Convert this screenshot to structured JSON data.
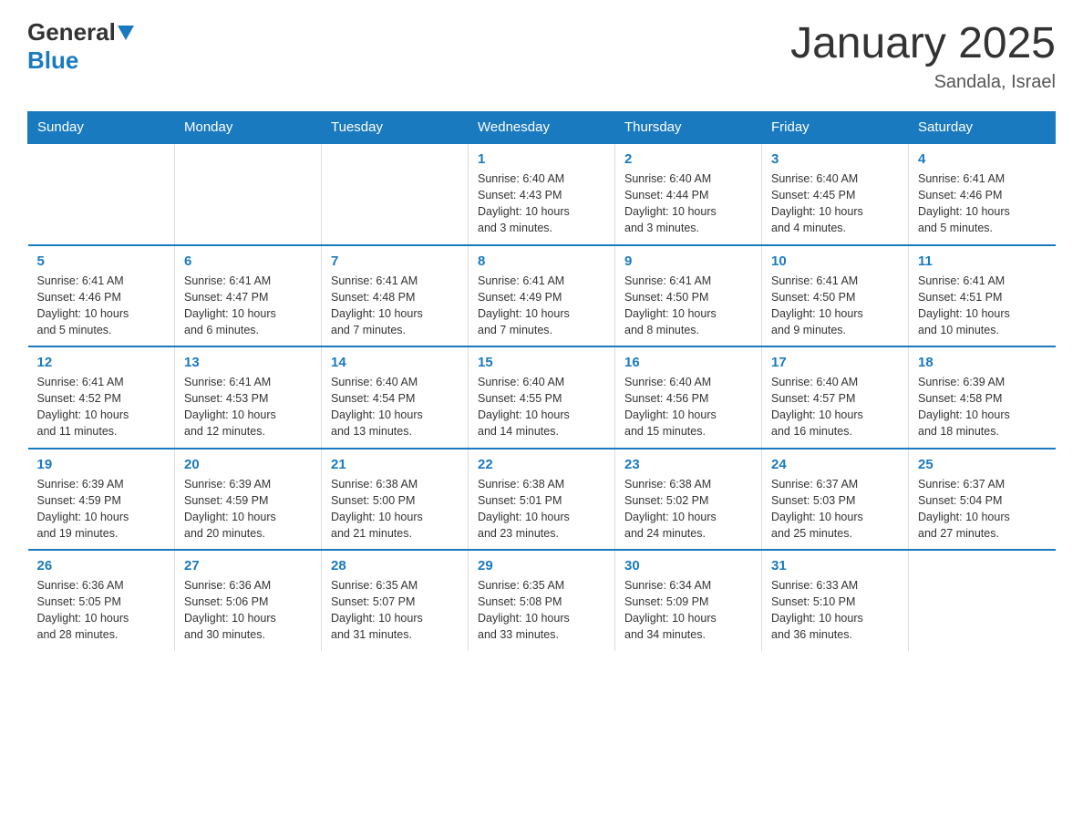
{
  "header": {
    "logo_general": "General",
    "logo_blue": "Blue",
    "month_title": "January 2025",
    "location": "Sandala, Israel"
  },
  "weekdays": [
    "Sunday",
    "Monday",
    "Tuesday",
    "Wednesday",
    "Thursday",
    "Friday",
    "Saturday"
  ],
  "weeks": [
    [
      {
        "day": "",
        "info": ""
      },
      {
        "day": "",
        "info": ""
      },
      {
        "day": "",
        "info": ""
      },
      {
        "day": "1",
        "info": "Sunrise: 6:40 AM\nSunset: 4:43 PM\nDaylight: 10 hours\nand 3 minutes."
      },
      {
        "day": "2",
        "info": "Sunrise: 6:40 AM\nSunset: 4:44 PM\nDaylight: 10 hours\nand 3 minutes."
      },
      {
        "day": "3",
        "info": "Sunrise: 6:40 AM\nSunset: 4:45 PM\nDaylight: 10 hours\nand 4 minutes."
      },
      {
        "day": "4",
        "info": "Sunrise: 6:41 AM\nSunset: 4:46 PM\nDaylight: 10 hours\nand 5 minutes."
      }
    ],
    [
      {
        "day": "5",
        "info": "Sunrise: 6:41 AM\nSunset: 4:46 PM\nDaylight: 10 hours\nand 5 minutes."
      },
      {
        "day": "6",
        "info": "Sunrise: 6:41 AM\nSunset: 4:47 PM\nDaylight: 10 hours\nand 6 minutes."
      },
      {
        "day": "7",
        "info": "Sunrise: 6:41 AM\nSunset: 4:48 PM\nDaylight: 10 hours\nand 7 minutes."
      },
      {
        "day": "8",
        "info": "Sunrise: 6:41 AM\nSunset: 4:49 PM\nDaylight: 10 hours\nand 7 minutes."
      },
      {
        "day": "9",
        "info": "Sunrise: 6:41 AM\nSunset: 4:50 PM\nDaylight: 10 hours\nand 8 minutes."
      },
      {
        "day": "10",
        "info": "Sunrise: 6:41 AM\nSunset: 4:50 PM\nDaylight: 10 hours\nand 9 minutes."
      },
      {
        "day": "11",
        "info": "Sunrise: 6:41 AM\nSunset: 4:51 PM\nDaylight: 10 hours\nand 10 minutes."
      }
    ],
    [
      {
        "day": "12",
        "info": "Sunrise: 6:41 AM\nSunset: 4:52 PM\nDaylight: 10 hours\nand 11 minutes."
      },
      {
        "day": "13",
        "info": "Sunrise: 6:41 AM\nSunset: 4:53 PM\nDaylight: 10 hours\nand 12 minutes."
      },
      {
        "day": "14",
        "info": "Sunrise: 6:40 AM\nSunset: 4:54 PM\nDaylight: 10 hours\nand 13 minutes."
      },
      {
        "day": "15",
        "info": "Sunrise: 6:40 AM\nSunset: 4:55 PM\nDaylight: 10 hours\nand 14 minutes."
      },
      {
        "day": "16",
        "info": "Sunrise: 6:40 AM\nSunset: 4:56 PM\nDaylight: 10 hours\nand 15 minutes."
      },
      {
        "day": "17",
        "info": "Sunrise: 6:40 AM\nSunset: 4:57 PM\nDaylight: 10 hours\nand 16 minutes."
      },
      {
        "day": "18",
        "info": "Sunrise: 6:39 AM\nSunset: 4:58 PM\nDaylight: 10 hours\nand 18 minutes."
      }
    ],
    [
      {
        "day": "19",
        "info": "Sunrise: 6:39 AM\nSunset: 4:59 PM\nDaylight: 10 hours\nand 19 minutes."
      },
      {
        "day": "20",
        "info": "Sunrise: 6:39 AM\nSunset: 4:59 PM\nDaylight: 10 hours\nand 20 minutes."
      },
      {
        "day": "21",
        "info": "Sunrise: 6:38 AM\nSunset: 5:00 PM\nDaylight: 10 hours\nand 21 minutes."
      },
      {
        "day": "22",
        "info": "Sunrise: 6:38 AM\nSunset: 5:01 PM\nDaylight: 10 hours\nand 23 minutes."
      },
      {
        "day": "23",
        "info": "Sunrise: 6:38 AM\nSunset: 5:02 PM\nDaylight: 10 hours\nand 24 minutes."
      },
      {
        "day": "24",
        "info": "Sunrise: 6:37 AM\nSunset: 5:03 PM\nDaylight: 10 hours\nand 25 minutes."
      },
      {
        "day": "25",
        "info": "Sunrise: 6:37 AM\nSunset: 5:04 PM\nDaylight: 10 hours\nand 27 minutes."
      }
    ],
    [
      {
        "day": "26",
        "info": "Sunrise: 6:36 AM\nSunset: 5:05 PM\nDaylight: 10 hours\nand 28 minutes."
      },
      {
        "day": "27",
        "info": "Sunrise: 6:36 AM\nSunset: 5:06 PM\nDaylight: 10 hours\nand 30 minutes."
      },
      {
        "day": "28",
        "info": "Sunrise: 6:35 AM\nSunset: 5:07 PM\nDaylight: 10 hours\nand 31 minutes."
      },
      {
        "day": "29",
        "info": "Sunrise: 6:35 AM\nSunset: 5:08 PM\nDaylight: 10 hours\nand 33 minutes."
      },
      {
        "day": "30",
        "info": "Sunrise: 6:34 AM\nSunset: 5:09 PM\nDaylight: 10 hours\nand 34 minutes."
      },
      {
        "day": "31",
        "info": "Sunrise: 6:33 AM\nSunset: 5:10 PM\nDaylight: 10 hours\nand 36 minutes."
      },
      {
        "day": "",
        "info": ""
      }
    ]
  ]
}
